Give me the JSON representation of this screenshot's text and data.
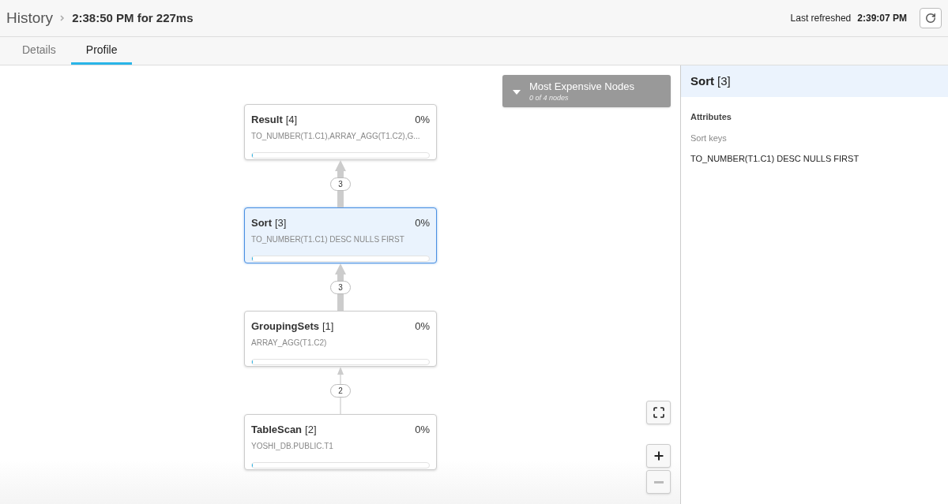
{
  "header": {
    "breadcrumb": "History",
    "title": "2:38:50 PM for 227ms",
    "refreshed_label": "Last refreshed",
    "refreshed_time": "2:39:07 PM"
  },
  "tabs": [
    {
      "label": "Details",
      "selected": false
    },
    {
      "label": "Profile",
      "selected": true
    }
  ],
  "expensive_panel": {
    "title": "Most Expensive Nodes",
    "subtitle": "0 of 4 nodes",
    "expanded": false
  },
  "nodes": [
    {
      "name": "Result",
      "index": "[4]",
      "percent": "0%",
      "detail": "TO_NUMBER(T1.C1),ARRAY_AGG(T1.C2),G...",
      "level": 0,
      "selected": false
    },
    {
      "name": "Sort",
      "index": "[3]",
      "percent": "0%",
      "detail": "TO_NUMBER(T1.C1) DESC NULLS FIRST",
      "level": 0,
      "selected": true
    },
    {
      "name": "GroupingSets",
      "index": "[1]",
      "percent": "0%",
      "detail": "ARRAY_AGG(T1.C2)",
      "level": 0,
      "selected": false
    },
    {
      "name": "TableScan",
      "index": "[2]",
      "percent": "0%",
      "detail": "YOSHI_DB.PUBLIC.T1",
      "level": 0,
      "selected": false
    }
  ],
  "edges": [
    {
      "label": "3",
      "kind": "thick"
    },
    {
      "label": "3",
      "kind": "thick"
    },
    {
      "label": "2",
      "kind": "thin"
    }
  ],
  "zoom_controls": [
    {
      "kind": "fit",
      "disabled": false
    },
    {
      "kind": "in",
      "disabled": false
    },
    {
      "kind": "out",
      "disabled": true
    }
  ],
  "detail_panel": {
    "name": "Sort",
    "index": "[3]",
    "section": "Attributes",
    "label": "Sort keys",
    "value": "TO_NUMBER(T1.C1) DESC NULLS FIRST"
  }
}
